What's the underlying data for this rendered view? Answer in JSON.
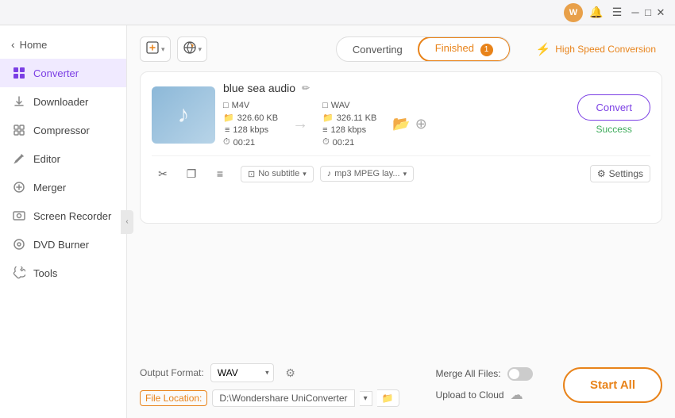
{
  "titlebar": {
    "avatar_initials": "W",
    "minimize_label": "─",
    "maximize_label": "□",
    "close_label": "✕"
  },
  "sidebar": {
    "back_label": "Home",
    "items": [
      {
        "id": "converter",
        "label": "Converter",
        "icon": "⬡",
        "active": true
      },
      {
        "id": "downloader",
        "label": "Downloader",
        "icon": "⬇"
      },
      {
        "id": "compressor",
        "label": "Compressor",
        "icon": "⧉"
      },
      {
        "id": "editor",
        "label": "Editor",
        "icon": "✏"
      },
      {
        "id": "merger",
        "label": "Merger",
        "icon": "⊕"
      },
      {
        "id": "screen-recorder",
        "label": "Screen Recorder",
        "icon": "◉"
      },
      {
        "id": "dvd-burner",
        "label": "DVD Burner",
        "icon": "⊙"
      },
      {
        "id": "tools",
        "label": "Tools",
        "icon": "⚙"
      }
    ]
  },
  "toolbar": {
    "add_file_label": "📄",
    "add_options_arrow": "▾",
    "add_url_label": "🔗",
    "add_url_arrow": "▾"
  },
  "tabs": {
    "converting_label": "Converting",
    "finished_label": "Finished",
    "finished_badge": "1"
  },
  "hsc": {
    "label": "High Speed Conversion",
    "icon": "⚡"
  },
  "file_card": {
    "title": "blue sea audio",
    "edit_icon": "✏",
    "source": {
      "format": "M4V",
      "bitrate": "128 kbps",
      "size": "326.60 KB",
      "duration": "00:21"
    },
    "target": {
      "format": "WAV",
      "bitrate": "128 kbps",
      "size": "326.11 KB",
      "duration": "00:21"
    },
    "extra_icons": {
      "icon1": "📂",
      "icon2": "⊞"
    },
    "actions": {
      "cut_icon": "✂",
      "copy_icon": "❐",
      "menu_icon": "≡",
      "subtitle_label": "No subtitle",
      "audio_label": "mp3 MPEG lay...",
      "settings_label": "Settings"
    },
    "convert_btn_label": "Convert",
    "success_label": "Success"
  },
  "bottom_bar": {
    "output_format_label": "Output Format:",
    "output_format_value": "WAV",
    "settings_gear_label": "⚙",
    "merge_label": "Merge All Files:",
    "file_location_label": "File Location:",
    "file_location_path": "D:\\Wondershare UniConverter",
    "upload_label": "Upload to Cloud",
    "upload_cloud_icon": "☁",
    "start_all_label": "Start All"
  }
}
